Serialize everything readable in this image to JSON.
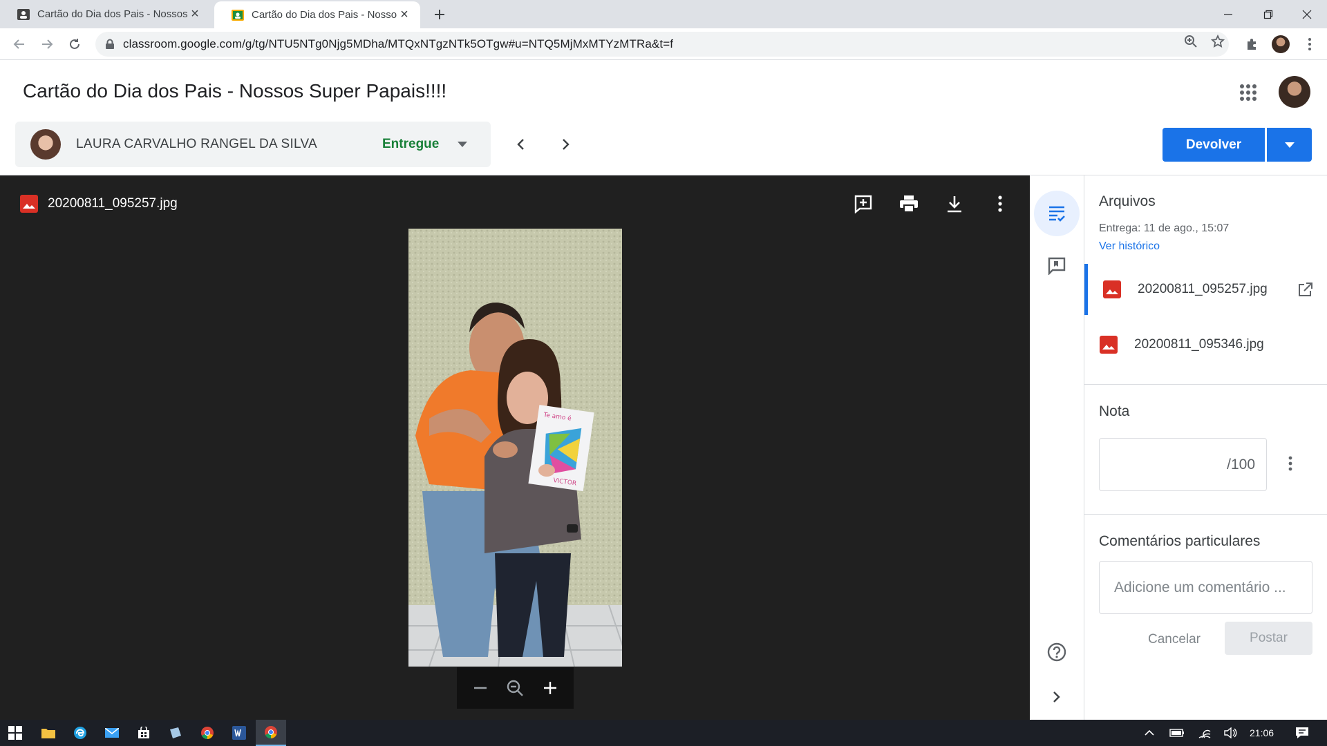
{
  "browser": {
    "tabs": [
      {
        "title": "Cartão do Dia dos Pais - Nossos Super Papais!!!!",
        "active": false
      },
      {
        "title": "Cartão do Dia dos Pais - Nossos Super Papais!!!!",
        "active": true
      }
    ],
    "url": "classroom.google.com/g/tg/NTU5NTg0Njg5MDha/MTQxNTgzNTk5OTgw#u=NTQ5MjMxMTYzMTRa&t=f"
  },
  "header": {
    "title": "Cartão do Dia dos Pais - Nossos Super Papais!!!!",
    "student": {
      "name": "LAURA CARVALHO RANGEL DA SILVA",
      "status": "Entregue"
    },
    "return_button": "Devolver"
  },
  "viewer": {
    "file_name": "20200811_095257.jpg",
    "card_text_top": "Te amo é",
    "card_text_bottom": "VICTOR"
  },
  "panel": {
    "files_title": "Arquivos",
    "submitted": "Entrega: 11 de ago., 15:07",
    "history_link": "Ver histórico",
    "files": [
      {
        "name": "20200811_095257.jpg",
        "selected": true
      },
      {
        "name": "20200811_095346.jpg",
        "selected": false
      }
    ],
    "grade_title": "Nota",
    "grade_suffix": "/100",
    "comments_title": "Comentários particulares",
    "comment_placeholder": "Adicione um comentário ...",
    "cancel_label": "Cancelar",
    "post_label": "Postar"
  },
  "taskbar": {
    "clock": "21:06"
  },
  "colors": {
    "accent": "#1a73e8",
    "status_green": "#188038",
    "viewer_bg": "#202020",
    "file_icon_red": "#d93025"
  }
}
